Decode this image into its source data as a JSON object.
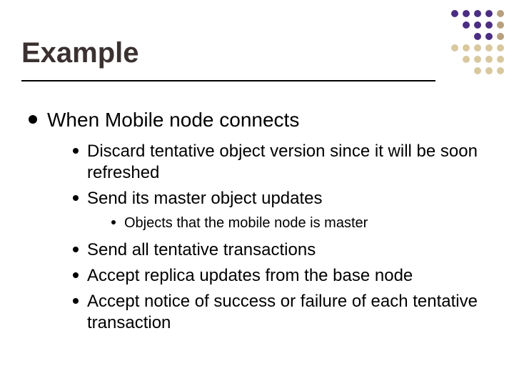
{
  "title": "Example",
  "body": [
    {
      "text": "When Mobile node connects",
      "children": [
        {
          "text": "Discard tentative object version since it will be soon refreshed"
        },
        {
          "text": "Send its master object updates",
          "children": [
            {
              "text": "Objects that the mobile node is master"
            }
          ]
        },
        {
          "text": "Send all tentative transactions"
        },
        {
          "text": "Accept replica updates from the base node"
        },
        {
          "text": "Accept notice of success or failure of each tentative transaction"
        }
      ]
    }
  ]
}
